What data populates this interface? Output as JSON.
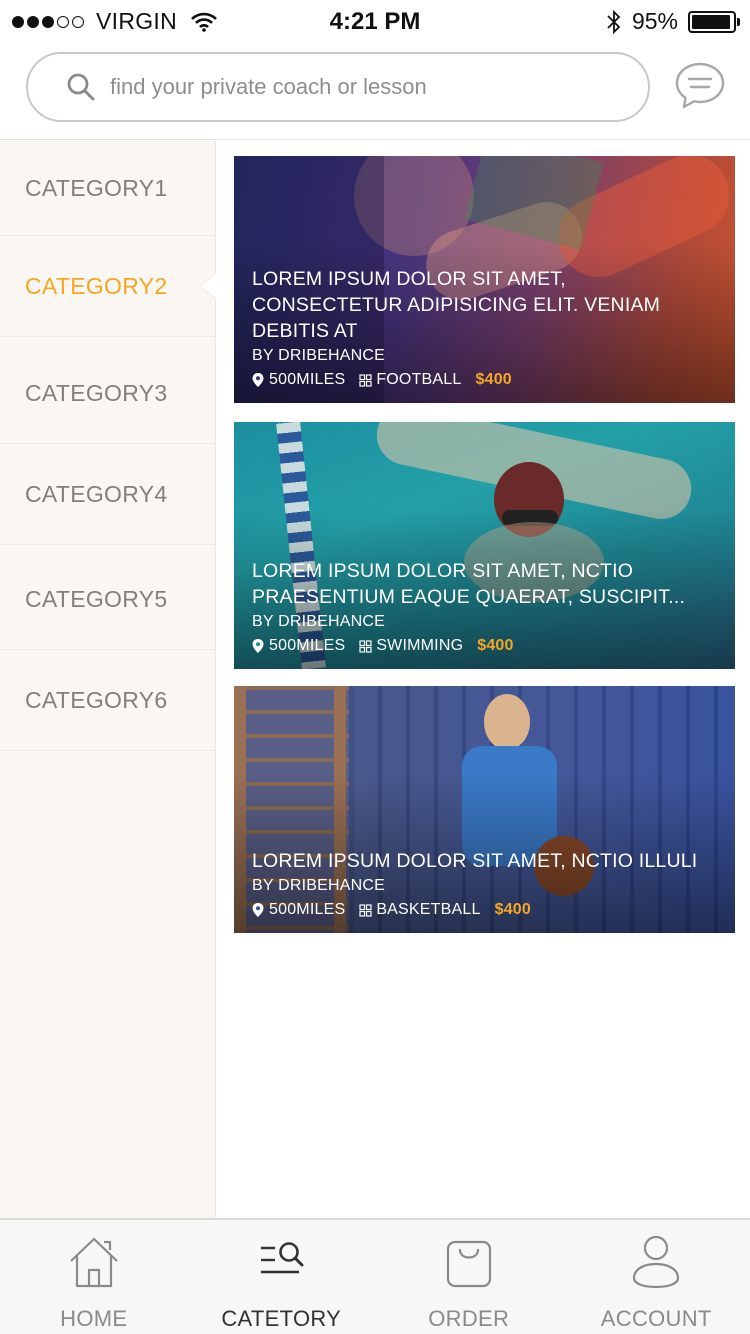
{
  "status_bar": {
    "carrier": "VIRGIN",
    "time": "4:21 PM",
    "battery": "95%",
    "battery_level": 0.95,
    "signal_bars_filled": 3,
    "signal_bars_total": 5
  },
  "search": {
    "placeholder": "find your private coach or lesson",
    "value": ""
  },
  "sidebar": {
    "active_index": 1,
    "items": [
      {
        "label": "CATEGORY1"
      },
      {
        "label": "CATEGORY2"
      },
      {
        "label": "CATEGORY3"
      },
      {
        "label": "CATEGORY4"
      },
      {
        "label": "CATEGORY5"
      },
      {
        "label": "CATEGORY6"
      }
    ]
  },
  "cards": [
    {
      "title": "LOREM IPSUM DOLOR SIT AMET, CONSECTETUR ADIPISICING ELIT. VENIAM DEBITIS AT",
      "by": "BY DRIBEHANCE",
      "distance": "500MILES",
      "sport": "FOOTBALL",
      "price": "$400"
    },
    {
      "title": "LOREM IPSUM DOLOR SIT AMET, NCTIO PRAESENTIUM EAQUE QUAERAT, SUSCIPIT...",
      "by": "BY DRIBEHANCE",
      "distance": "500MILES",
      "sport": "SWIMMING",
      "price": "$400"
    },
    {
      "title": "LOREM IPSUM DOLOR SIT AMET, NCTIO ILLULI",
      "by": "BY DRIBEHANCE",
      "distance": "500MILES",
      "sport": "BASKETBALL",
      "price": "$400"
    }
  ],
  "tabbar": {
    "active_index": 1,
    "tabs": [
      {
        "label": "HOME",
        "icon": "home-icon"
      },
      {
        "label": "CATETORY",
        "icon": "category-search-icon"
      },
      {
        "label": "ORDER",
        "icon": "shopping-bag-icon"
      },
      {
        "label": "ACCOUNT",
        "icon": "user-icon"
      }
    ]
  },
  "colors": {
    "accent": "#f5a623",
    "sidebar_bg": "#faf7f2",
    "muted_text": "#808080"
  }
}
